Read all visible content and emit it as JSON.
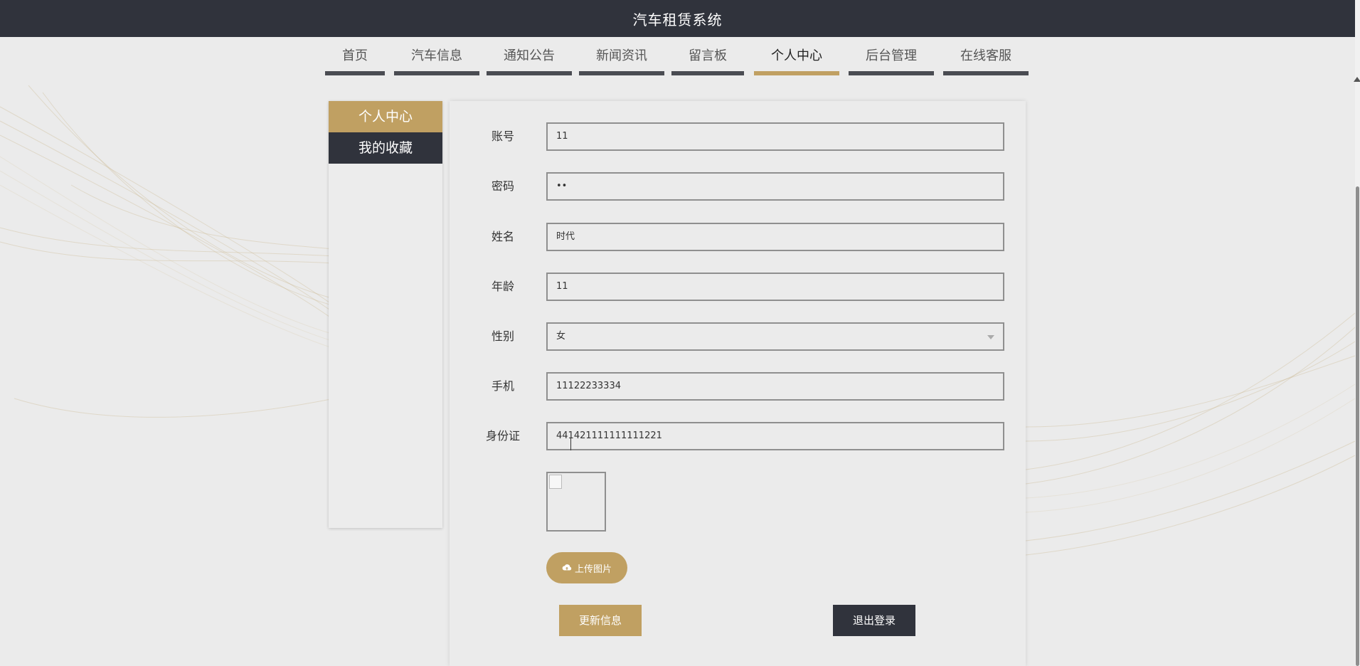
{
  "header": {
    "title": "汽车租赁系统"
  },
  "nav": {
    "items": [
      {
        "label": "首页"
      },
      {
        "label": "汽车信息"
      },
      {
        "label": "通知公告"
      },
      {
        "label": "新闻资讯"
      },
      {
        "label": "留言板"
      },
      {
        "label": "个人中心",
        "active": true
      },
      {
        "label": "后台管理"
      },
      {
        "label": "在线客服"
      }
    ]
  },
  "sidebar": {
    "items": [
      {
        "label": "个人中心",
        "active": true
      },
      {
        "label": "我的收藏"
      }
    ]
  },
  "form": {
    "account": {
      "label": "账号",
      "value": "11"
    },
    "password": {
      "label": "密码",
      "value": "••"
    },
    "name": {
      "label": "姓名",
      "value": "时代"
    },
    "age": {
      "label": "年龄",
      "value": "11"
    },
    "gender": {
      "label": "性别",
      "value": "女"
    },
    "phone": {
      "label": "手机",
      "value": "11122233334"
    },
    "id_card": {
      "label": "身份证",
      "value": "441421111111111221"
    }
  },
  "upload": {
    "label": "上传图片",
    "icon": "cloud-upload-icon"
  },
  "actions": {
    "update_label": "更新信息",
    "logout_label": "退出登录"
  },
  "colors": {
    "accent": "#c0a062",
    "dark": "#30333c",
    "background": "#ebebeb"
  }
}
